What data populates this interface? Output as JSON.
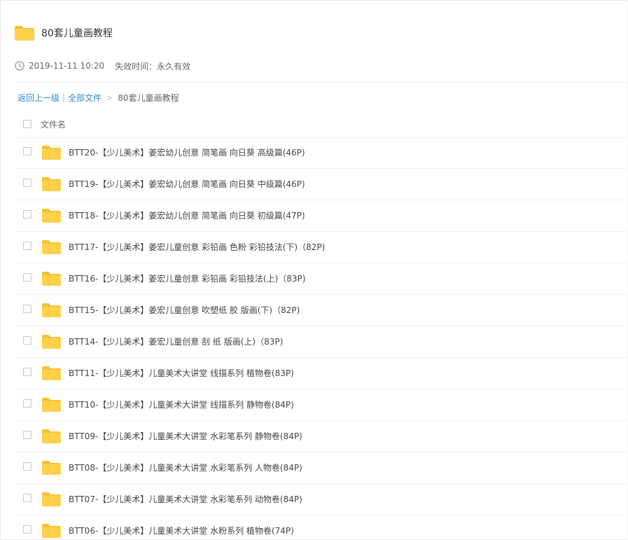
{
  "share": {
    "title": "80套儿童画教程",
    "date": "2019-11-11 10:20",
    "expiry_label": "失效时间：",
    "expiry_value": "永久有效"
  },
  "breadcrumb": {
    "back": "返回上一级",
    "separator": "|",
    "all_files": "全部文件",
    "arrow": ">",
    "current": "80套儿童画教程"
  },
  "list": {
    "header": "文件名",
    "items": [
      "BTT20-【少儿美术】姜宏幼儿创意 简笔画 向日葵 高级篇(46P)",
      "BTT19-【少儿美术】姜宏幼儿创意 简笔画 向日葵 中级篇(46P)",
      "BTT18-【少儿美术】姜宏幼儿创意 简笔画 向日葵 初级篇(47P)",
      "BTT17-【少儿美术】姜宏儿童创意 彩铅画 色粉 彩铅技法(下)（82P)",
      "BTT16-【少儿美术】姜宏儿童创意 彩铅画 彩铅技法(上)（83P)",
      "BTT15-【少儿美术】姜宏儿童创意 吹塑纸 胶 版画(下)（82P)",
      "BTT14-【少儿美术】姜宏儿童创意 刮 纸 版画(上)（83P)",
      "BTT11-【少儿美术】儿童美术大讲堂 线描系列 植物卷(83P)",
      "BTT10-【少儿美术】儿童美术大讲堂 线描系列 静物卷(84P)",
      "BTT09-【少儿美术】儿童美术大讲堂 水彩笔系列 静物卷(84P)",
      "BTT08-【少儿美术】儿童美术大讲堂 水彩笔系列 人物卷(84P)",
      "BTT07-【少儿美术】儿童美术大讲堂 水彩笔系列 动物卷(84P)",
      "BTT06-【少儿美术】儿童美术大讲堂 水粉系列 植物卷(74P)"
    ]
  },
  "colors": {
    "folder": "#ffd04a",
    "folder_tab": "#f5bf2e",
    "link": "#2f88d3"
  },
  "icons": {
    "folder": "folder-icon",
    "clock": "clock-icon",
    "checkbox": "checkbox"
  }
}
